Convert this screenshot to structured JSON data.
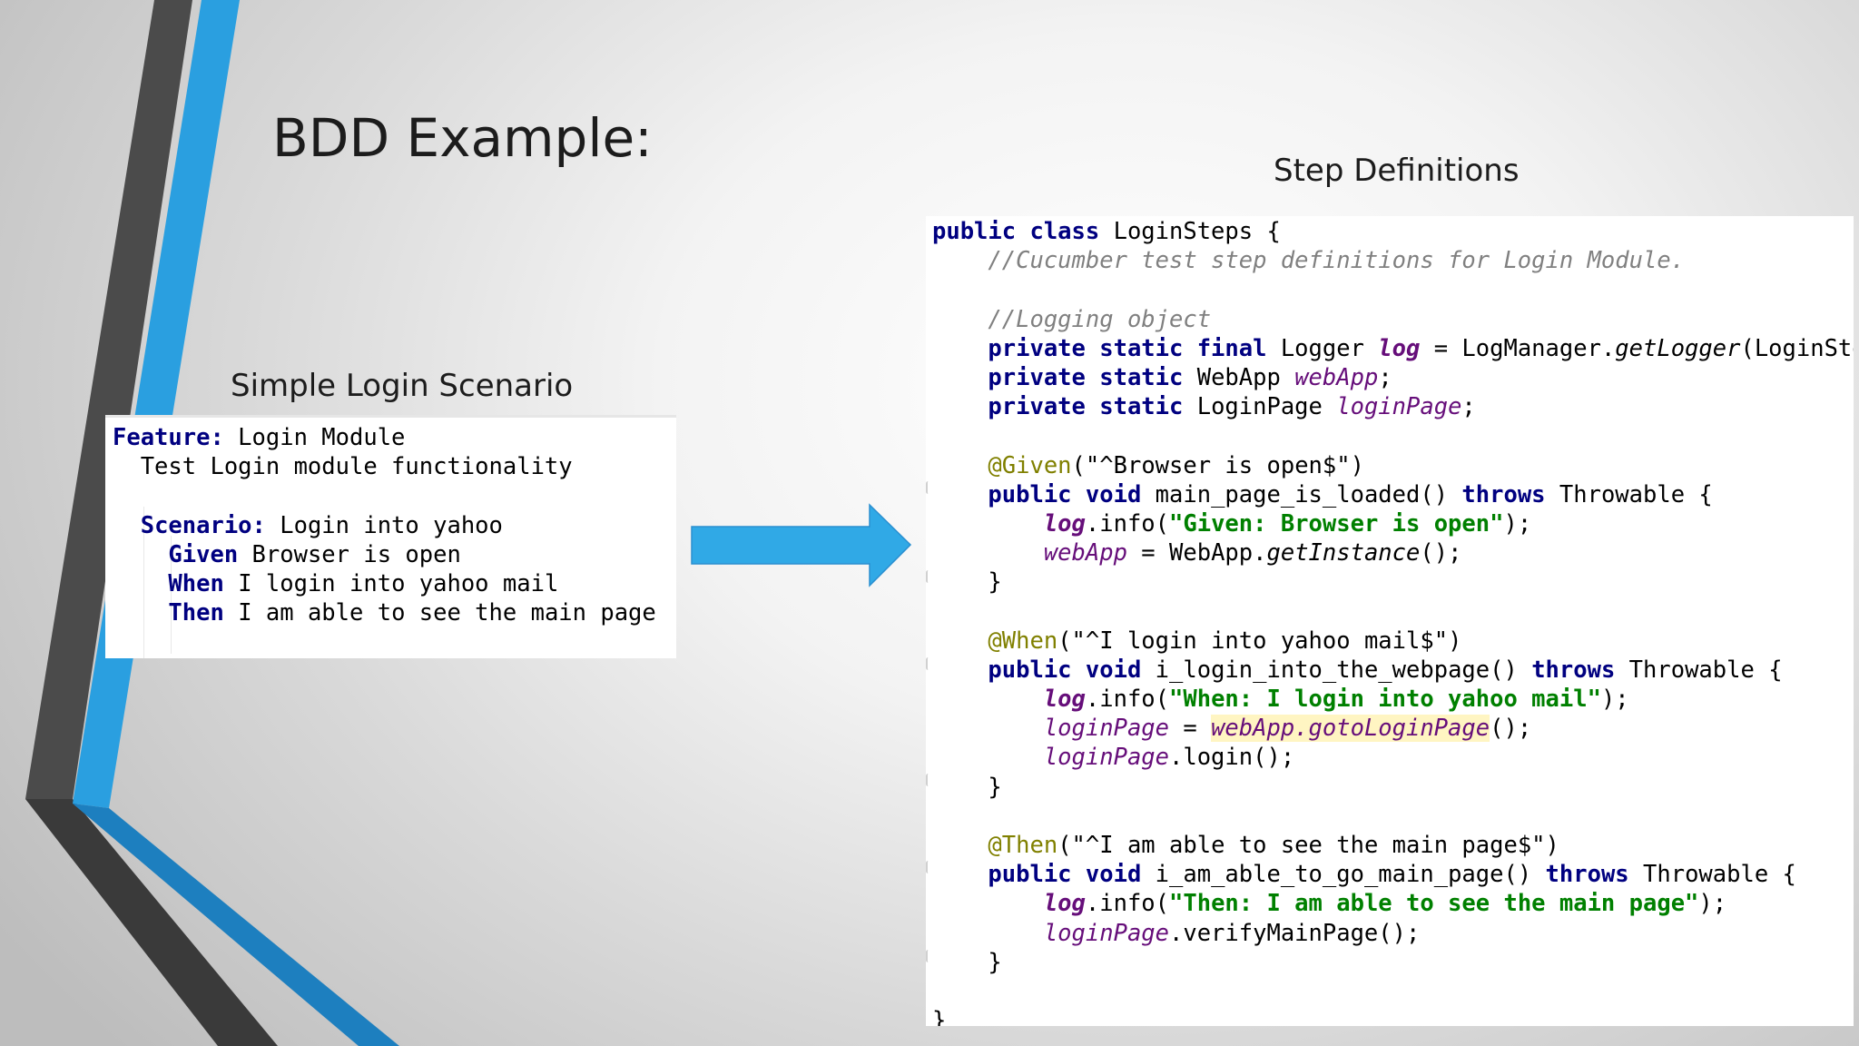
{
  "slide": {
    "title": "BDD Example:",
    "left_caption": "Simple Login Scenario",
    "right_caption": "Step Definitions"
  },
  "feature_lines": [
    [
      {
        "t": "Feature:",
        "c": "kw"
      },
      {
        "t": " Login Module"
      }
    ],
    [
      {
        "t": "  Test Login module functionality"
      }
    ],
    [
      {
        "t": ""
      }
    ],
    [
      {
        "t": "  "
      },
      {
        "t": "Scenario:",
        "c": "kw"
      },
      {
        "t": " Login into yahoo"
      }
    ],
    [
      {
        "t": "    "
      },
      {
        "t": "Given",
        "c": "kw"
      },
      {
        "t": " Browser is open"
      }
    ],
    [
      {
        "t": "    "
      },
      {
        "t": "When",
        "c": "kw"
      },
      {
        "t": " I login into yahoo mail"
      }
    ],
    [
      {
        "t": "    "
      },
      {
        "t": "Then",
        "c": "kw"
      },
      {
        "t": " I am able to see the main page"
      }
    ]
  ],
  "code_lines": [
    [
      {
        "t": "public class",
        "c": "kw"
      },
      {
        "t": " LoginSteps {"
      }
    ],
    [
      {
        "t": "    "
      },
      {
        "t": "//Cucumber test step definitions for Login Module.",
        "c": "comment"
      }
    ],
    [
      {
        "t": ""
      }
    ],
    [
      {
        "t": "    "
      },
      {
        "t": "//Logging object",
        "c": "comment"
      }
    ],
    [
      {
        "t": "    "
      },
      {
        "t": "private static final",
        "c": "kw"
      },
      {
        "t": " Logger "
      },
      {
        "t": "log",
        "c": "field-b"
      },
      {
        "t": " = LogManager."
      },
      {
        "t": "getLogger",
        "c": "ital"
      },
      {
        "t": "(LoginSteps.class);"
      }
    ],
    [
      {
        "t": "    "
      },
      {
        "t": "private static",
        "c": "kw"
      },
      {
        "t": " WebApp "
      },
      {
        "t": "webApp",
        "c": "field"
      },
      {
        "t": ";"
      }
    ],
    [
      {
        "t": "    "
      },
      {
        "t": "private static",
        "c": "kw"
      },
      {
        "t": " LoginPage "
      },
      {
        "t": "loginPage",
        "c": "field"
      },
      {
        "t": ";"
      }
    ],
    [
      {
        "t": ""
      }
    ],
    [
      {
        "t": "    "
      },
      {
        "t": "@Given",
        "c": "anno"
      },
      {
        "t": "("
      },
      {
        "t": "\"^Browser is open$\"",
        "c": "str-plain"
      },
      {
        "t": ")"
      }
    ],
    [
      {
        "t": "    "
      },
      {
        "t": "public void",
        "c": "kw"
      },
      {
        "t": " main_page_is_loaded() "
      },
      {
        "t": "throws",
        "c": "kw"
      },
      {
        "t": " Throwable {"
      }
    ],
    [
      {
        "t": "        "
      },
      {
        "t": "log",
        "c": "field-b"
      },
      {
        "t": ".info("
      },
      {
        "t": "\"Given: Browser is open\"",
        "c": "str"
      },
      {
        "t": ");"
      }
    ],
    [
      {
        "t": "        "
      },
      {
        "t": "webApp",
        "c": "field"
      },
      {
        "t": " = WebApp."
      },
      {
        "t": "getInstance",
        "c": "ital"
      },
      {
        "t": "();"
      }
    ],
    [
      {
        "t": "    }"
      }
    ],
    [
      {
        "t": ""
      }
    ],
    [
      {
        "t": "    "
      },
      {
        "t": "@When",
        "c": "anno"
      },
      {
        "t": "("
      },
      {
        "t": "\"^I login into yahoo mail$\"",
        "c": "str-plain"
      },
      {
        "t": ")"
      }
    ],
    [
      {
        "t": "    "
      },
      {
        "t": "public void",
        "c": "kw"
      },
      {
        "t": " i_login_into_the_webpage() "
      },
      {
        "t": "throws",
        "c": "kw"
      },
      {
        "t": " Throwable {"
      }
    ],
    [
      {
        "t": "        "
      },
      {
        "t": "log",
        "c": "field-b"
      },
      {
        "t": ".info("
      },
      {
        "t": "\"When: I login into yahoo mail\"",
        "c": "str"
      },
      {
        "t": ");"
      }
    ],
    [
      {
        "t": "        "
      },
      {
        "t": "loginPage",
        "c": "field"
      },
      {
        "t": " = "
      },
      {
        "t": "webApp.gotoLoginPage",
        "c": "field hl"
      },
      {
        "t": "();"
      }
    ],
    [
      {
        "t": "        "
      },
      {
        "t": "loginPage",
        "c": "field"
      },
      {
        "t": ".login();"
      }
    ],
    [
      {
        "t": "    }"
      }
    ],
    [
      {
        "t": ""
      }
    ],
    [
      {
        "t": "    "
      },
      {
        "t": "@Then",
        "c": "anno"
      },
      {
        "t": "("
      },
      {
        "t": "\"^I am able to see the main page$\"",
        "c": "str-plain"
      },
      {
        "t": ")"
      }
    ],
    [
      {
        "t": "    "
      },
      {
        "t": "public void",
        "c": "kw"
      },
      {
        "t": " i_am_able_to_go_main_page() "
      },
      {
        "t": "throws",
        "c": "kw"
      },
      {
        "t": " Throwable {"
      }
    ],
    [
      {
        "t": "        "
      },
      {
        "t": "log",
        "c": "field-b"
      },
      {
        "t": ".info("
      },
      {
        "t": "\"Then: I am able to see the main page\"",
        "c": "str"
      },
      {
        "t": ");"
      }
    ],
    [
      {
        "t": "        "
      },
      {
        "t": "loginPage",
        "c": "field"
      },
      {
        "t": ".verifyMainPage();"
      }
    ],
    [
      {
        "t": "    }"
      }
    ],
    [
      {
        "t": ""
      }
    ],
    [
      {
        "t": "}"
      }
    ]
  ],
  "colors": {
    "accent_blue": "#2a9fe0",
    "dark_stripe": "#4a4a4a",
    "arrow_blue": "#30a9e6"
  }
}
